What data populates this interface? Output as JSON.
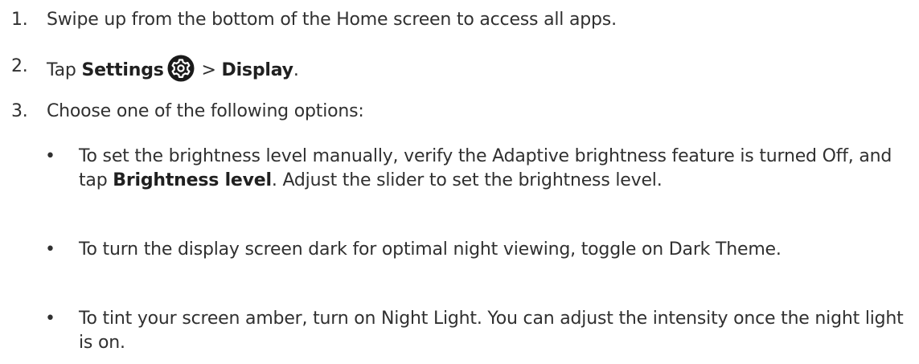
{
  "steps": [
    {
      "number": "1.",
      "text": "Swipe up from the bottom of the Home screen to access all apps."
    },
    {
      "number": "2.",
      "prefix": "Tap ",
      "settings_label": "Settings",
      "icon": "settings-gear-icon",
      "separator": " > ",
      "display_label": "Display",
      "suffix": "."
    },
    {
      "number": "3.",
      "text": "Choose one of the following options:"
    }
  ],
  "bullets": [
    {
      "marker": "•",
      "text_before": "To set the brightness level manually, verify the Adaptive brightness feature is turned Off, and tap ",
      "bold": "Brightness level",
      "text_after": ". Adjust the slider to set the brightness level."
    },
    {
      "marker": "•",
      "text": "To turn the display screen dark for optimal night viewing, toggle on Dark Theme."
    },
    {
      "marker": "•",
      "text": "To tint your screen amber, turn on Night Light. You can adjust the intensity once the night light is on."
    }
  ],
  "colors": {
    "text": "#303030",
    "icon_bg": "#1a1a1a",
    "icon_fg": "#ffffff"
  }
}
